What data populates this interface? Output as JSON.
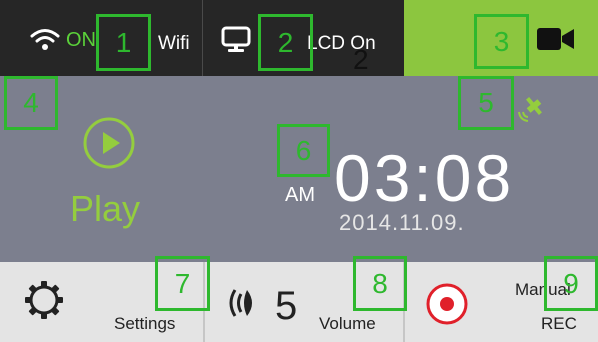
{
  "colors": {
    "topbar_bg": "#262626",
    "camera_active_bg": "#8cc63f",
    "main_bg": "#7c7f8e",
    "accent_green": "#94cd3e",
    "bottombar_bg": "#e4e4e4",
    "record_red": "#e0202a",
    "annotation_green": "#2eb82e"
  },
  "topbar": {
    "wifi": {
      "icon": "wifi-icon",
      "status": "ON",
      "label": "Wifi"
    },
    "lcd": {
      "icon": "monitor-icon",
      "label": "LCD On",
      "annotation": "2"
    },
    "camera": {
      "icon": "video-camera-icon",
      "active": true
    }
  },
  "main": {
    "play": {
      "icon": "play-circle-icon",
      "label": "Play"
    },
    "gps": {
      "icon": "gps-satellite-icon"
    },
    "clock": {
      "ampm": "AM",
      "time": "03:08",
      "date": "2014.11.09."
    }
  },
  "bottombar": {
    "settings": {
      "icon": "gear-icon",
      "label": "Settings"
    },
    "volume": {
      "icon": "speaker-icon",
      "value": "5",
      "label": "Volume"
    },
    "record": {
      "icon": "record-icon",
      "label_line1": "Manual",
      "label_line2": "REC"
    }
  },
  "annotations": [
    "1",
    "2",
    "3",
    "4",
    "5",
    "6",
    "7",
    "8",
    "9"
  ]
}
